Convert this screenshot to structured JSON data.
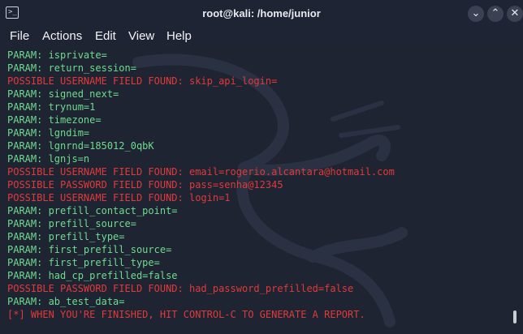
{
  "window": {
    "title": "root@kali: /home/junior",
    "app_icon_glyph": ">_",
    "buttons": {
      "minimize": "⌄",
      "maximize": "⌃",
      "close": "✕"
    }
  },
  "menu": [
    "File",
    "Actions",
    "Edit",
    "View",
    "Help"
  ],
  "terminal": {
    "lines": [
      {
        "kind": "param",
        "text": "PARAM: isprivate="
      },
      {
        "kind": "param",
        "text": "PARAM: return_session="
      },
      {
        "kind": "alert",
        "text": "POSSIBLE USERNAME FIELD FOUND: skip_api_login="
      },
      {
        "kind": "param",
        "text": "PARAM: signed_next="
      },
      {
        "kind": "param",
        "text": "PARAM: trynum=1"
      },
      {
        "kind": "param",
        "text": "PARAM: timezone="
      },
      {
        "kind": "param",
        "text": "PARAM: lgndim="
      },
      {
        "kind": "param",
        "text": "PARAM: lgnrnd=185012_0qbK"
      },
      {
        "kind": "param",
        "text": "PARAM: lgnjs=n"
      },
      {
        "kind": "alert",
        "text": "POSSIBLE USERNAME FIELD FOUND: email=rogerio.alcantara@hotmail.com"
      },
      {
        "kind": "alert",
        "text": "POSSIBLE PASSWORD FIELD FOUND: pass=senha@12345"
      },
      {
        "kind": "alert",
        "text": "POSSIBLE USERNAME FIELD FOUND: login=1"
      },
      {
        "kind": "param",
        "text": "PARAM: prefill_contact_point="
      },
      {
        "kind": "param",
        "text": "PARAM: prefill_source="
      },
      {
        "kind": "param",
        "text": "PARAM: prefill_type="
      },
      {
        "kind": "param",
        "text": "PARAM: first_prefill_source="
      },
      {
        "kind": "param",
        "text": "PARAM: first_prefill_type="
      },
      {
        "kind": "param",
        "text": "PARAM: had_cp_prefilled=false"
      },
      {
        "kind": "alert",
        "text": "POSSIBLE PASSWORD FIELD FOUND: had_password_prefilled=false"
      },
      {
        "kind": "param",
        "text": "PARAM: ab_test_data="
      },
      {
        "kind": "alert",
        "text": "[*] WHEN YOU'RE FINISHED, HIT CONTROL-C TO GENERATE A REPORT."
      }
    ]
  },
  "colors": {
    "background": "#1e2431",
    "param_text": "#6fdc8f",
    "alert_text": "#e13a3a"
  }
}
